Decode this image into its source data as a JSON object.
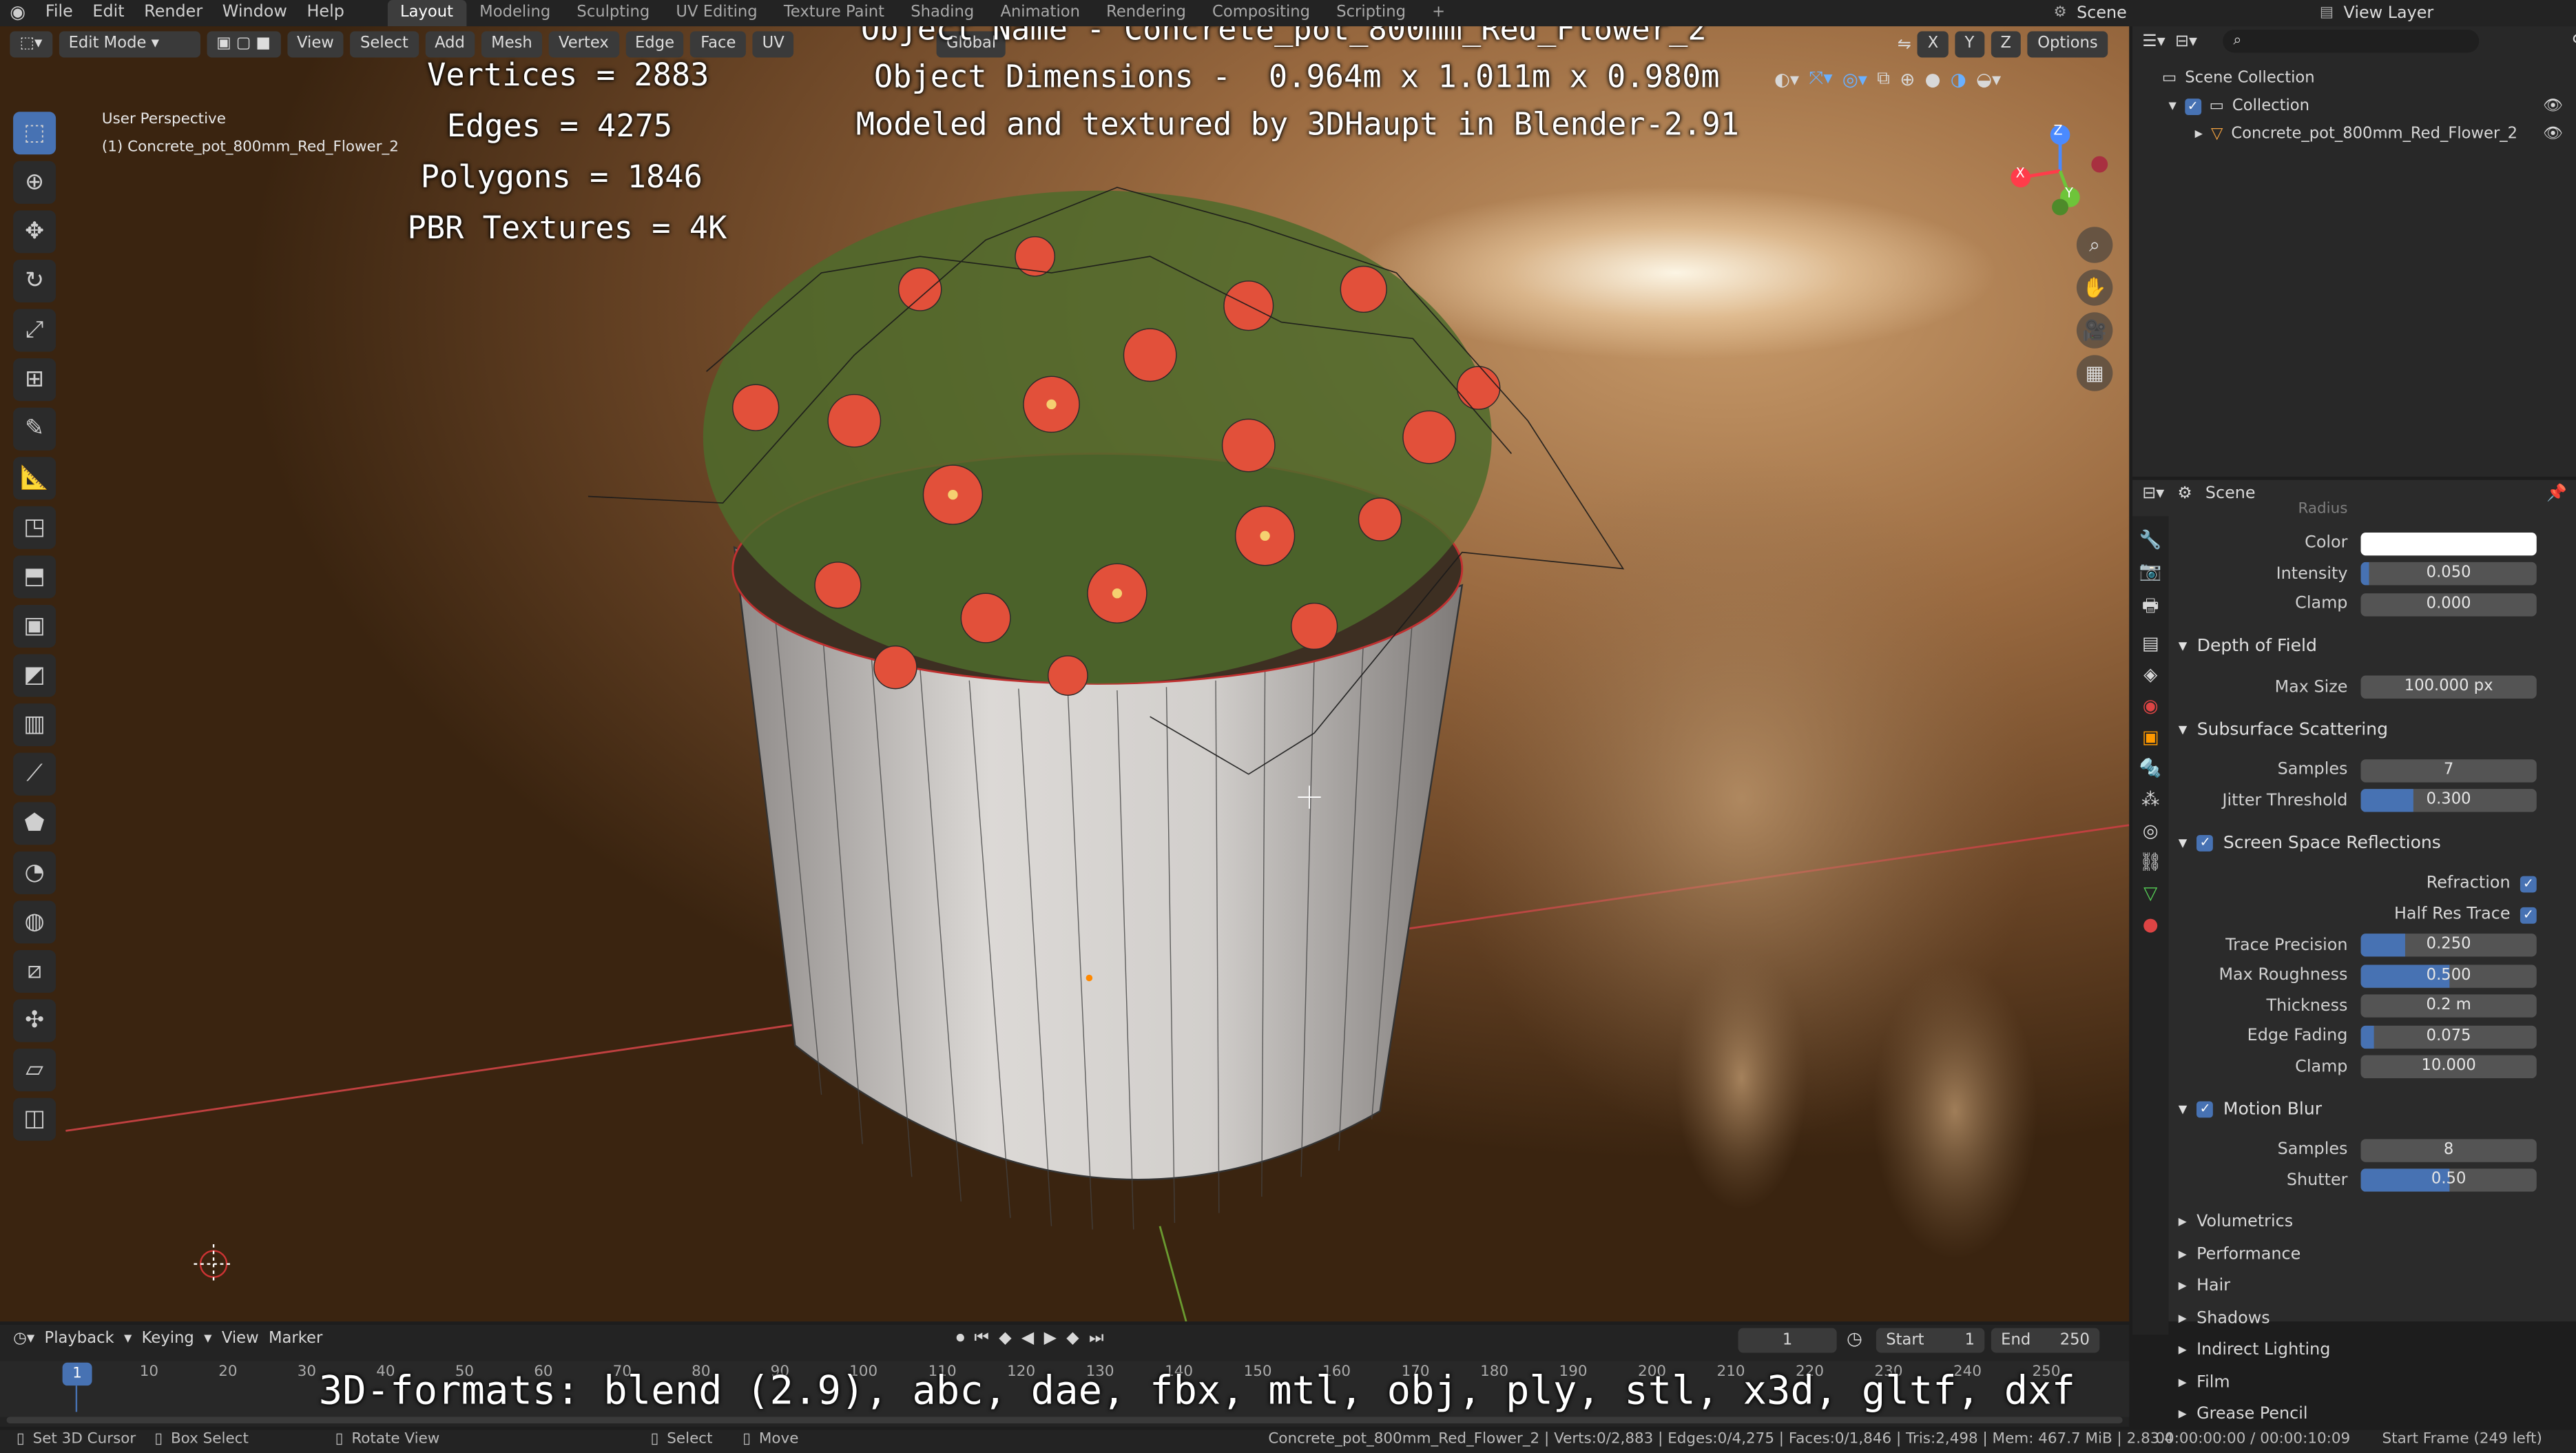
{
  "topbar": {
    "menus": [
      "File",
      "Edit",
      "Render",
      "Window",
      "Help"
    ],
    "workspaces": [
      "Layout",
      "Modeling",
      "Sculpting",
      "UV Editing",
      "Texture Paint",
      "Shading",
      "Animation",
      "Rendering",
      "Compositing",
      "Scripting"
    ],
    "active_workspace": "Layout",
    "add_workspace": "+",
    "scene_name": "Scene",
    "view_layer": "View Layer"
  },
  "viewport": {
    "mode": "Edit Mode",
    "menus": [
      "View",
      "Select",
      "Add",
      "Mesh",
      "Vertex",
      "Edge",
      "Face",
      "UV"
    ],
    "orientation": "Global",
    "options_label": "Options",
    "axes": [
      "X",
      "Y",
      "Z"
    ],
    "perspective_label": "User Perspective",
    "object_label": "(1) Concrete_pot_800mm_Red_Flower_2",
    "overlay": {
      "object_name": "Object Name - Concrete_pot_800mm_Red_Flower_2",
      "dimensions": "Object Dimensions -  0.964m x 1.011m x 0.980m",
      "credit": "Modeled and textured by 3DHaupt in Blender-2.91",
      "vertices": "Vertices = 2883",
      "edges": "Edges = 4275",
      "polygons": "Polygons = 1846",
      "textures": "PBR Textures = 4K",
      "formats": "3D-formats: blend (2.9), abc, dae, fbx, mtl, obj, ply, stl, x3d, gltf, dxf"
    },
    "gizmo_axes": [
      "Z",
      "X",
      "Y"
    ]
  },
  "outliner": {
    "search_placeholder": "",
    "root": "Scene Collection",
    "collection": "Collection",
    "object": "Concrete_pot_800mm_Red_Flower_2"
  },
  "properties": {
    "context": "Scene",
    "partial_row": "Radius",
    "color_label": "Color",
    "color_value": "#ffffff",
    "intensity": {
      "label": "Intensity",
      "value": "0.050",
      "fill": 0.05
    },
    "clamp_top": {
      "label": "Clamp",
      "value": "0.000"
    },
    "dof_header": "Depth of Field",
    "max_size": {
      "label": "Max Size",
      "value": "100.000 px"
    },
    "sss_header": "Subsurface Scattering",
    "sss_samples": {
      "label": "Samples",
      "value": "7"
    },
    "jitter": {
      "label": "Jitter Threshold",
      "value": "0.300",
      "fill": 0.3
    },
    "ssr_header": "Screen Space Reflections",
    "refraction_label": "Refraction",
    "half_res_label": "Half Res Trace",
    "trace_precision": {
      "label": "Trace Precision",
      "value": "0.250",
      "fill": 0.25
    },
    "max_roughness": {
      "label": "Max Roughness",
      "value": "0.500",
      "fill": 0.5
    },
    "thickness": {
      "label": "Thickness",
      "value": "0.2 m"
    },
    "edge_fading": {
      "label": "Edge Fading",
      "value": "0.075",
      "fill": 0.075
    },
    "clamp_ssr": {
      "label": "Clamp",
      "value": "10.000"
    },
    "mb_header": "Motion Blur",
    "mb_samples": {
      "label": "Samples",
      "value": "8"
    },
    "shutter": {
      "label": "Shutter",
      "value": "0.50",
      "fill": 0.5
    },
    "collapsed": [
      "Volumetrics",
      "Performance",
      "Hair",
      "Shadows",
      "Indirect Lighting",
      "Film",
      "Grease Pencil"
    ]
  },
  "timeline": {
    "menus": [
      "Playback",
      "Keying",
      "View",
      "Marker"
    ],
    "current_frame": "1",
    "start_label": "Start",
    "start": "1",
    "end_label": "End",
    "end": "250",
    "ticks": [
      "10",
      "20",
      "30",
      "40",
      "50",
      "60",
      "70",
      "80",
      "90",
      "100",
      "110",
      "120",
      "130",
      "140",
      "150",
      "160",
      "170",
      "180",
      "190",
      "200",
      "210",
      "220",
      "230",
      "240",
      "250"
    ],
    "playhead": "1"
  },
  "statusbar": {
    "left": [
      "Set 3D Cursor",
      "Box Select",
      "Rotate View",
      "Select",
      "Move"
    ],
    "stats": "Concrete_pot_800mm_Red_Flower_2 | Verts:0/2,883 | Edges:0/4,275 | Faces:0/1,846 | Tris:2,498 | Mem: 467.7 MiB | 2.83.4",
    "time": "00:00:00:00 / 00:00:10:09",
    "frame_info": "Start Frame (249 left)"
  }
}
